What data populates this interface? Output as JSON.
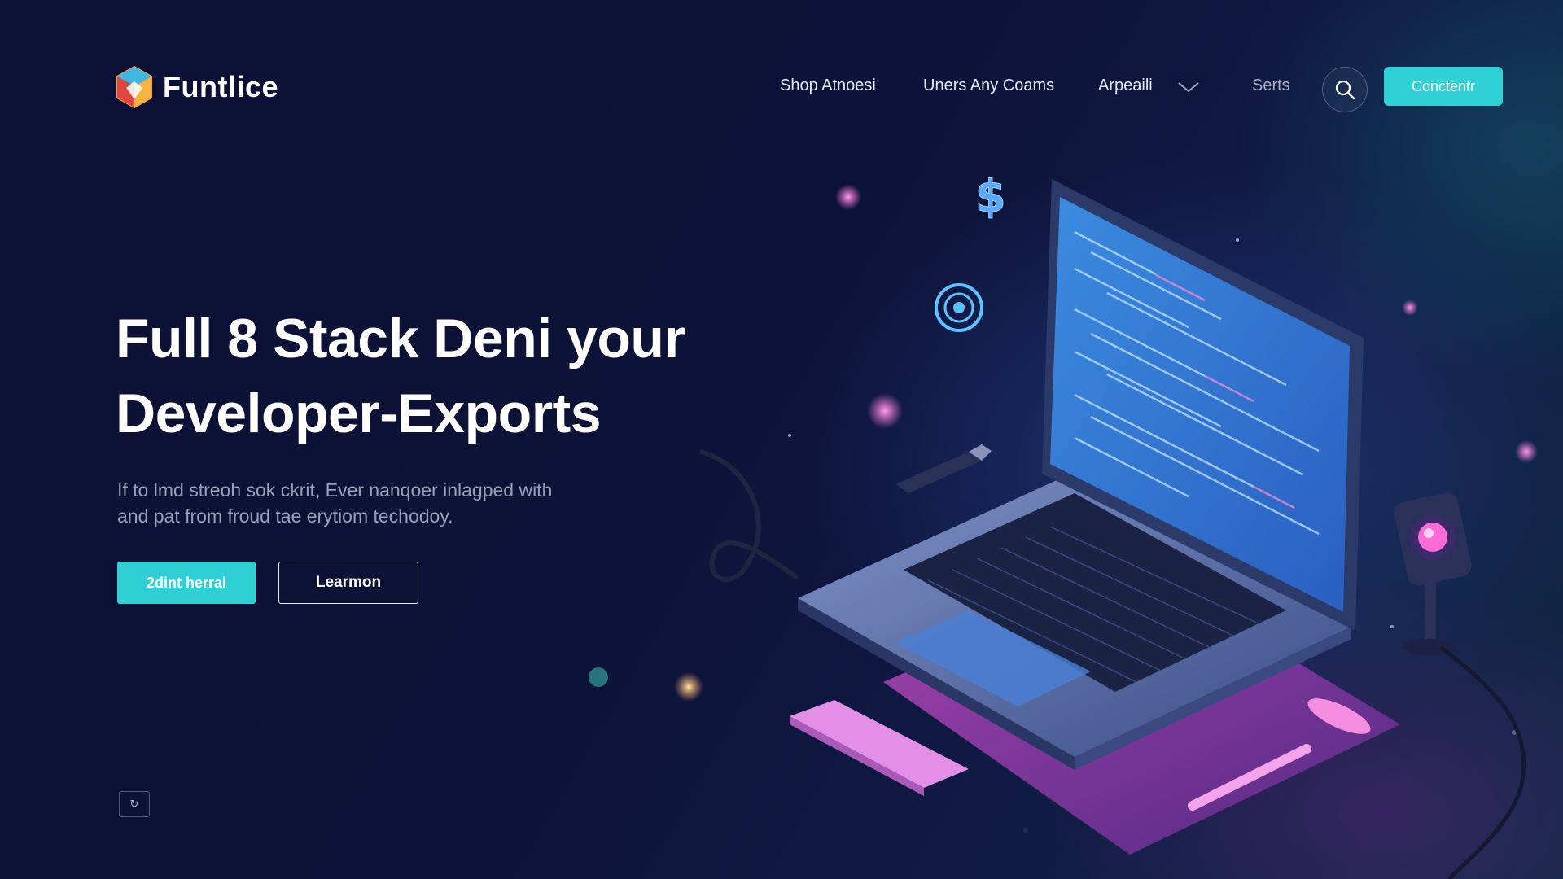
{
  "brand": {
    "name": "Funtlice",
    "logo_icon": "cube-logo-icon"
  },
  "nav": {
    "links": [
      "Shop Atnoesi",
      "Uners Any Coams",
      "Arpeaili",
      "Serts"
    ],
    "dropdown_icon": "chevron-down-icon",
    "search_icon": "search-icon",
    "cta_label": "Conctentr"
  },
  "hero": {
    "title_lines": [
      "Full 8 Stack Deni your",
      "Developer-Exports"
    ],
    "subtitle_lines": [
      "If to lmd streoh sok ckrit, Ever nanqoer inlagped with",
      "and pat from froud tae erytiom techodoy."
    ],
    "primary_label": "2dint herral",
    "secondary_label": "Learmon"
  },
  "scroll_indicator": "↻",
  "colors": {
    "accent": "#2fd1d6",
    "background": "#0c1033",
    "screen": "#2f7fd6",
    "neon_pink": "#ff6bd6"
  },
  "illustration": {
    "floating_icons": [
      "dollar-icon",
      "target-icon"
    ],
    "objects": [
      "laptop",
      "usb-drive",
      "cable",
      "webcam",
      "stylus-pen",
      "phone"
    ]
  }
}
